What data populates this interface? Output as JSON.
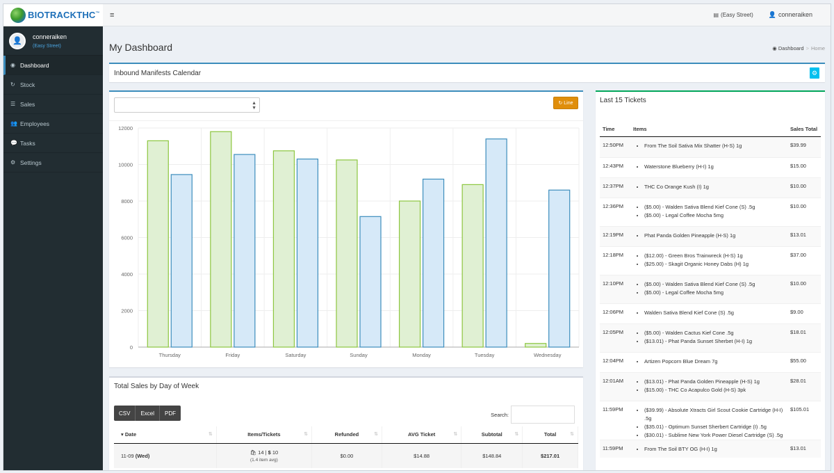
{
  "brand": {
    "name": "BIOTRACKTHC",
    "mark": "™"
  },
  "topbar": {
    "menu_icon": "≡",
    "store_label": "(Easy Street)",
    "user_label": "conneraiken"
  },
  "sidebar": {
    "user": {
      "name": "conneraiken",
      "location": "(Easy Street)"
    },
    "items": [
      {
        "label": "Dashboard",
        "icon": "dashboard-icon",
        "active": true
      },
      {
        "label": "Stock",
        "icon": "refresh-icon",
        "active": false
      },
      {
        "label": "Sales",
        "icon": "list-icon",
        "active": false
      },
      {
        "label": "Employees",
        "icon": "users-icon",
        "active": false
      },
      {
        "label": "Tasks",
        "icon": "comments-icon",
        "active": false
      },
      {
        "label": "Settings",
        "icon": "cogs-icon",
        "active": false
      }
    ]
  },
  "page": {
    "title": "My Dashboard",
    "breadcrumb": {
      "dashboard": "Dashboard",
      "home": "Home"
    }
  },
  "calendar_box": {
    "title": "Inbound Manifests Calendar"
  },
  "chart_box": {
    "line_button": "Line"
  },
  "chart_data": {
    "type": "bar",
    "categories": [
      "Thursday",
      "Friday",
      "Saturday",
      "Sunday",
      "Monday",
      "Tuesday",
      "Wednesday"
    ],
    "series": [
      {
        "values": [
          11300,
          11800,
          10750,
          10250,
          8000,
          8900,
          200
        ],
        "color": "#8cc63f",
        "fill": "#e0f0d3"
      },
      {
        "values": [
          9450,
          10550,
          10300,
          7150,
          9200,
          11400,
          8600
        ],
        "color": "#3c8dbc",
        "fill": "#d6e9f8"
      }
    ],
    "ylim": [
      0,
      12000
    ],
    "yticks": [
      0,
      2000,
      4000,
      6000,
      8000,
      10000,
      12000
    ],
    "grid": true
  },
  "sales_box": {
    "title": "Total Sales by Day of Week",
    "buttons": [
      "CSV",
      "Excel",
      "PDF"
    ],
    "search_label": "Search:",
    "columns": [
      "Date",
      "Items/Tickets",
      "Refunded",
      "AVG Ticket",
      "Subtotal",
      "Total"
    ],
    "rows": [
      {
        "date": "11-09",
        "day": "(Wed)",
        "items": "14",
        "tickets": "10",
        "avg": "(1.4 item avg)",
        "refunded": "$0.00",
        "avg_ticket": "$14.88",
        "subtotal": "$148.84",
        "total": "$217.01"
      }
    ]
  },
  "tickets_box": {
    "title": "Last 15 Tickets",
    "columns": {
      "time": "Time",
      "items": "Items",
      "total": "Sales Total"
    },
    "rows": [
      {
        "time": "12:50PM",
        "items": [
          "From The Soil Sativa Mix Shatter (H-S) 1g"
        ],
        "total": "$39.99"
      },
      {
        "time": "12:43PM",
        "items": [
          "Waterstone Blueberry (H-I) 1g"
        ],
        "total": "$15.00"
      },
      {
        "time": "12:37PM",
        "items": [
          "THC Co Orange Kush (I) 1g"
        ],
        "total": "$10.00"
      },
      {
        "time": "12:36PM",
        "items": [
          "($5.00) - Walden Sativa Blend Kief Cone (S) .5g",
          "($5.00) - Legal Coffee Mocha 5mg"
        ],
        "total": "$10.00"
      },
      {
        "time": "12:19PM",
        "items": [
          "Phat Panda Golden Pineapple (H-S) 1g"
        ],
        "total": "$13.01"
      },
      {
        "time": "12:18PM",
        "items": [
          "($12.00) - Green Bros Trainwreck (H-S) 1g",
          "($25.00) - Skagit Organic Honey Dabs (H) 1g"
        ],
        "total": "$37.00"
      },
      {
        "time": "12:10PM",
        "items": [
          "($5.00) - Walden Sativa Blend Kief Cone (S) .5g",
          "($5.00) - Legal Coffee Mocha 5mg"
        ],
        "total": "$10.00"
      },
      {
        "time": "12:06PM",
        "items": [
          "Walden Sativa Blend Kief Cone (S) .5g"
        ],
        "total": "$9.00"
      },
      {
        "time": "12:05PM",
        "items": [
          "($5.00) - Walden Cactus Kief Cone .5g",
          "($13.01) - Phat Panda Sunset Sherbet (H-I) 1g"
        ],
        "total": "$18.01"
      },
      {
        "time": "12:04PM",
        "items": [
          "Artizen Popcorn Blue Dream 7g"
        ],
        "total": "$55.00"
      },
      {
        "time": "12:01AM",
        "items": [
          "($13.01) - Phat Panda Golden Pineapple (H-S) 1g",
          "($15.00) - THC Co Acapulco Gold (H-S) 3pk"
        ],
        "total": "$28.01"
      },
      {
        "time": "11:59PM",
        "items": [
          "($39.99) - Absolute Xtracts Girl Scout Cookie Cartridge (H-I) .5g",
          "($35.01) - Optimum Sunset Sherbert Cartridge (I) .5g",
          "($30.01) - Sublime New York Power Diesel Cartridge (S) .5g"
        ],
        "total": "$105.01"
      },
      {
        "time": "11:59PM",
        "items": [
          "From The Soil BTY OG (H-I) 1g"
        ],
        "total": "$13.01"
      }
    ]
  }
}
